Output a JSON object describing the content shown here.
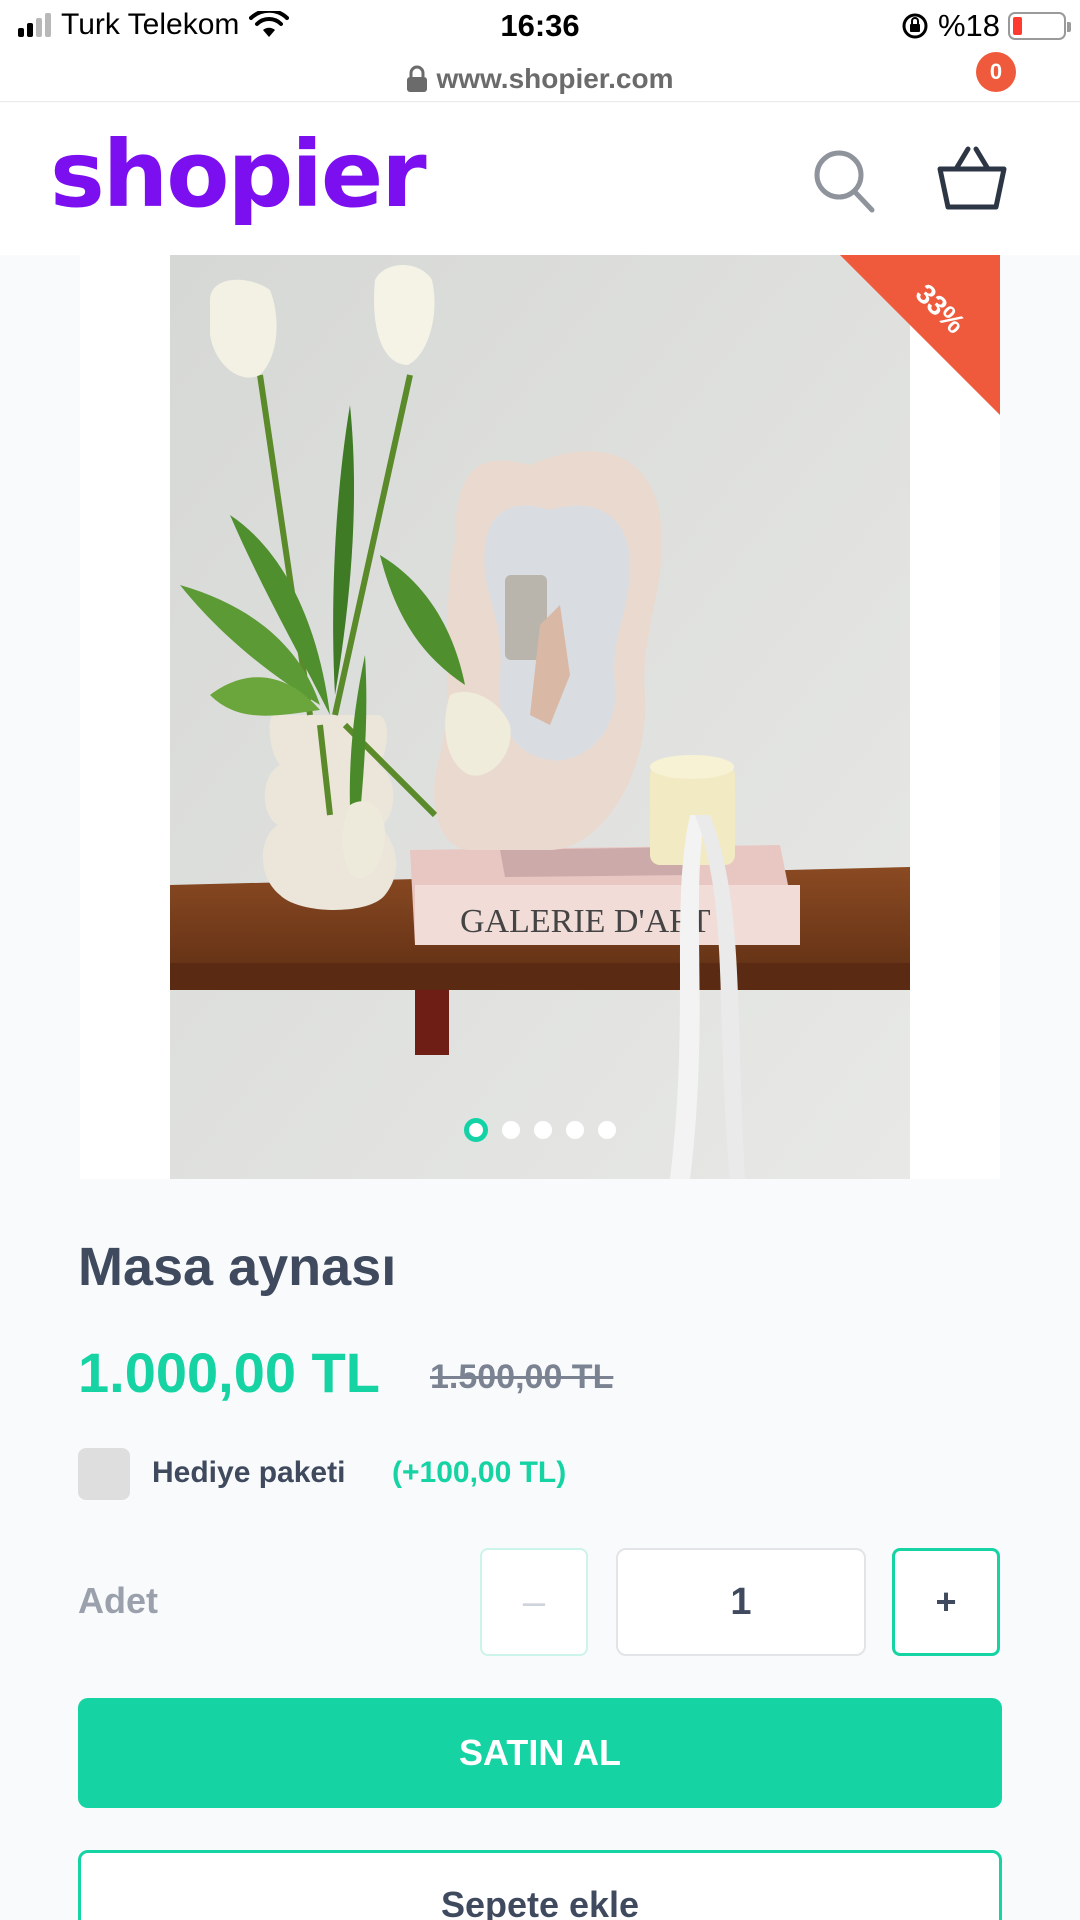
{
  "status_bar": {
    "carrier": "Turk Telekom",
    "time": "16:36",
    "battery": "%18",
    "battery_level": 0.18
  },
  "browser": {
    "url": "www.shopier.com"
  },
  "header": {
    "logo": "shopier",
    "cart_count": "0"
  },
  "product": {
    "discount_badge": "33%",
    "image_count": 5,
    "active_image": 1,
    "title": "Masa aynası",
    "price": "1.000,00 TL",
    "old_price": "1.500,00 TL",
    "gift_label": "Hediye paketi",
    "gift_extra": "(+100,00 TL)",
    "gift_checked": false,
    "quantity_label": "Adet",
    "quantity_value": "1",
    "minus_label": "–",
    "plus_label": "+",
    "buy_button": "SATIN AL",
    "add_to_cart_button": "Sepete ekle"
  },
  "colors": {
    "brand": "#7b0ff0",
    "accent": "#16d3a4",
    "badge": "#f05a3c"
  }
}
